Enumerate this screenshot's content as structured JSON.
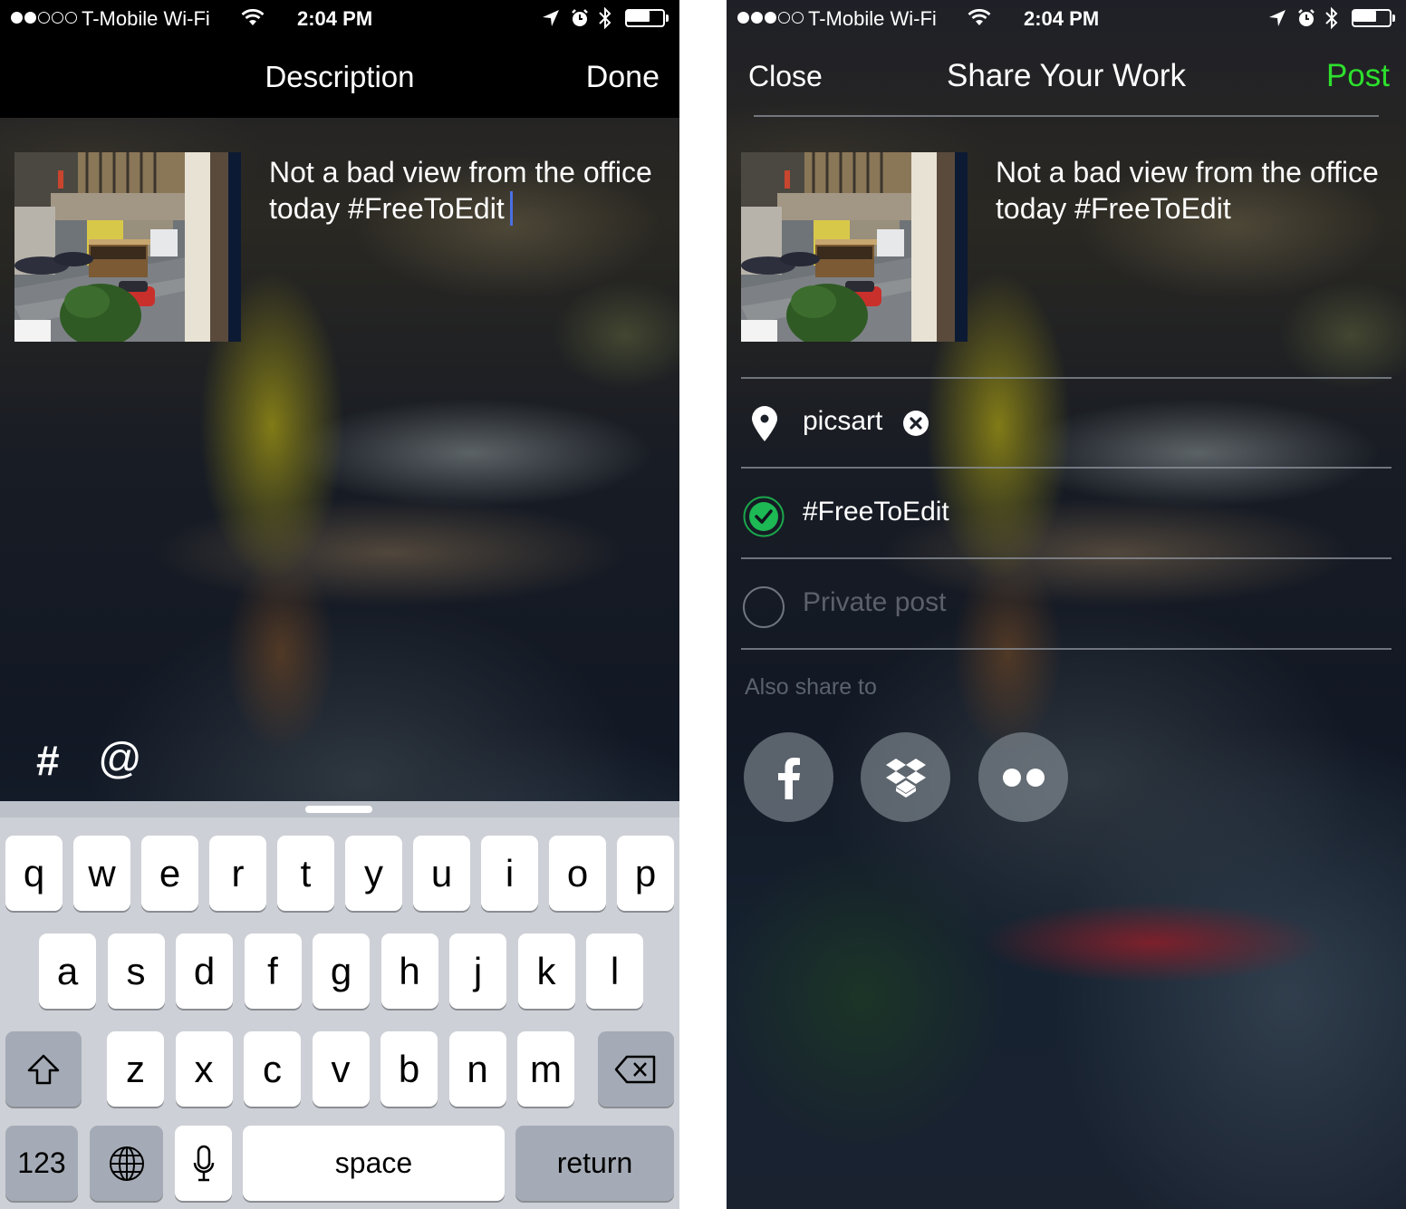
{
  "left_screen": {
    "status_bar": {
      "signal_filled": 2,
      "signal_total": 5,
      "carrier": "T-Mobile Wi-Fi",
      "time": "2:04 PM",
      "battery_level": 0.7,
      "icons": [
        "wifi-icon",
        "location-arrow-icon",
        "alarm-clock-icon",
        "bluetooth-icon",
        "battery-icon"
      ]
    },
    "nav": {
      "title": "Description",
      "done_label": "Done"
    },
    "post": {
      "thumbnail_alt": "cable car street view photo",
      "description_text": "Not a bad view from the office today #FreeToEdit"
    },
    "shortcuts": {
      "hashtag_label": "#",
      "mention_label": "@"
    },
    "keyboard": {
      "row1": [
        "q",
        "w",
        "e",
        "r",
        "t",
        "y",
        "u",
        "i",
        "o",
        "p"
      ],
      "row2": [
        "a",
        "s",
        "d",
        "f",
        "g",
        "h",
        "j",
        "k",
        "l"
      ],
      "row3": [
        "z",
        "x",
        "c",
        "v",
        "b",
        "n",
        "m"
      ],
      "numbers_label": "123",
      "space_label": "space",
      "return_label": "return",
      "icons": [
        "shift-icon",
        "backspace-icon",
        "globe-icon",
        "microphone-icon"
      ]
    }
  },
  "right_screen": {
    "status_bar": {
      "signal_filled": 3,
      "signal_total": 5,
      "carrier": "T-Mobile Wi-Fi",
      "time": "2:04 PM",
      "battery_level": 0.7
    },
    "nav": {
      "close_label": "Close",
      "title": "Share Your Work",
      "post_label": "Post",
      "post_color": "#2de02d"
    },
    "post": {
      "thumbnail_alt": "cable car street view photo",
      "description_text": "Not a bad view from the office today #FreeToEdit"
    },
    "options": {
      "location": {
        "icon": "map-pin-icon",
        "label": "picsart",
        "clear_icon": "clear-x-icon"
      },
      "free_to_edit": {
        "label": "#FreeToEdit",
        "checked": true,
        "check_color": "#1db954"
      },
      "private_post": {
        "label": "Private post",
        "checked": false
      }
    },
    "share": {
      "label": "Also share to",
      "services": [
        {
          "name": "Facebook",
          "icon": "facebook-icon"
        },
        {
          "name": "Dropbox",
          "icon": "dropbox-icon"
        },
        {
          "name": "Flickr",
          "icon": "flickr-icon"
        }
      ]
    }
  }
}
